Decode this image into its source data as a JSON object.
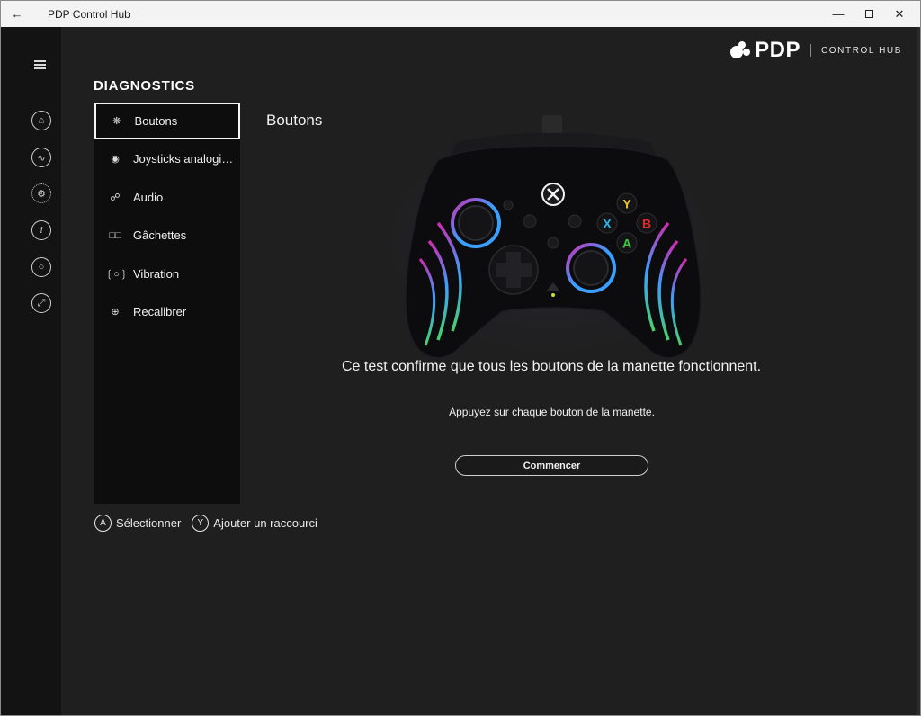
{
  "window": {
    "title": "PDP Control Hub",
    "back_icon": "back-arrow-icon",
    "minimize_icon": "minimize-icon",
    "maximize_icon": "maximize-icon",
    "close_icon": "close-icon"
  },
  "brand": {
    "logo_text": "PDP",
    "product": "CONTROL HUB"
  },
  "rail": {
    "items": [
      {
        "icon": "menu-icon"
      },
      {
        "icon": "home-icon"
      },
      {
        "icon": "activity-icon"
      },
      {
        "icon": "settings-gear-icon"
      },
      {
        "icon": "info-icon"
      },
      {
        "icon": "controller-icon"
      },
      {
        "icon": "expand-icon"
      }
    ]
  },
  "diagnostics": {
    "title": "DIAGNOSTICS",
    "items": [
      {
        "label": "Boutons",
        "icon": "buttons-icon",
        "selected": true
      },
      {
        "label": "Joysticks analogiques",
        "icon": "joystick-icon"
      },
      {
        "label": "Audio",
        "icon": "headset-icon"
      },
      {
        "label": "Gâchettes",
        "icon": "triggers-icon"
      },
      {
        "label": "Vibration",
        "icon": "vibration-icon"
      },
      {
        "label": "Recalibrer",
        "icon": "recalibrate-icon"
      }
    ]
  },
  "hints": {
    "select_key": "A",
    "select_label": "Sélectionner",
    "shortcut_key": "Y",
    "shortcut_label": "Ajouter un raccourci"
  },
  "content": {
    "title": "Boutons",
    "description": "Ce test confirme que tous les boutons de la manette fonctionnent.",
    "instruction": "Appuyez sur chaque bouton de la manette.",
    "start_button": "Commencer",
    "face_buttons": {
      "y": "Y",
      "x": "X",
      "b": "B",
      "a": "A"
    }
  },
  "colors": {
    "background": "#1f1f20",
    "panel": "#0d0d0d",
    "rail": "#131313",
    "button_y": "#e8c22a",
    "button_x": "#2ab6e8",
    "button_b": "#e02a2a",
    "button_a": "#3ad03a",
    "ring_blue": "#3aa0ff",
    "ring_pink": "#d02ab0"
  }
}
